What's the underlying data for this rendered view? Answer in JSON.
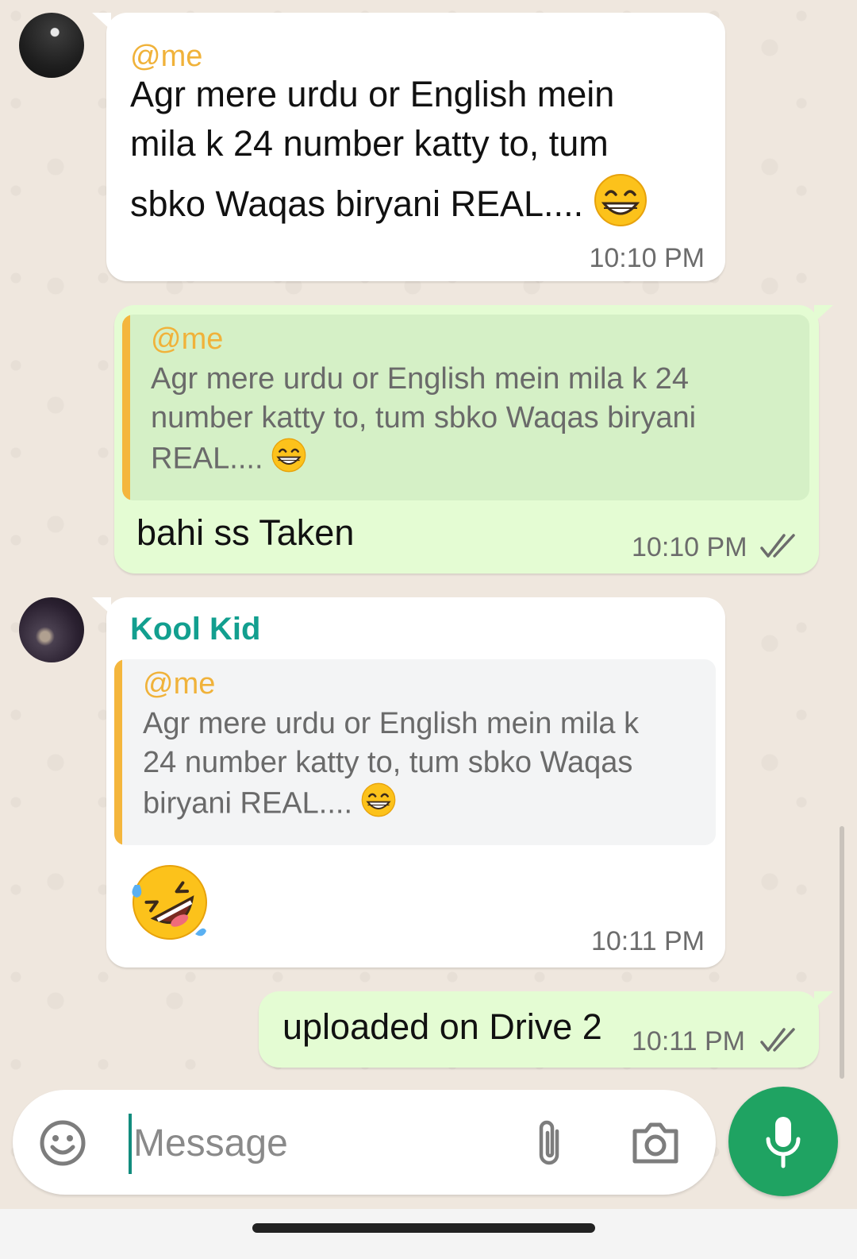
{
  "messages": [
    {
      "direction": "incoming",
      "mention": "@me",
      "text_line1": "Agr mere urdu or English mein",
      "text_line2": "mila k 24 number katty to, tum",
      "text_line3": "sbko Waqas biryani REAL....",
      "emoji": "grinning-squinting-emoji",
      "time": "10:10 PM"
    },
    {
      "direction": "outgoing",
      "quote": {
        "mention": "@me",
        "line1": "Agr mere urdu or English mein mila k 24",
        "line2": "number katty to, tum sbko Waqas biryani",
        "line3": "REAL...."
      },
      "text": "bahi ss Taken",
      "time": "10:10 PM",
      "status": "read"
    },
    {
      "direction": "incoming",
      "sender": "Kool Kid",
      "quote": {
        "mention": "@me",
        "line1": "Agr mere urdu or English mein mila k",
        "line2": "24 number katty to, tum sbko Waqas",
        "line3": "biryani REAL...."
      },
      "emoji": "rolling-on-floor-laughing-emoji",
      "time": "10:11 PM"
    },
    {
      "direction": "outgoing",
      "text": "uploaded on Drive 2",
      "time": "10:11 PM",
      "status": "read"
    }
  ],
  "composer": {
    "placeholder": "Message"
  },
  "colors": {
    "wallpaper": "#efe7de",
    "outgoing_bubble": "#e4fcd3",
    "incoming_bubble": "#ffffff",
    "mention": "#f0b23a",
    "sender_name": "#129f8f",
    "mic_button": "#1fa362",
    "read_ticks": "#6c6c6c"
  }
}
